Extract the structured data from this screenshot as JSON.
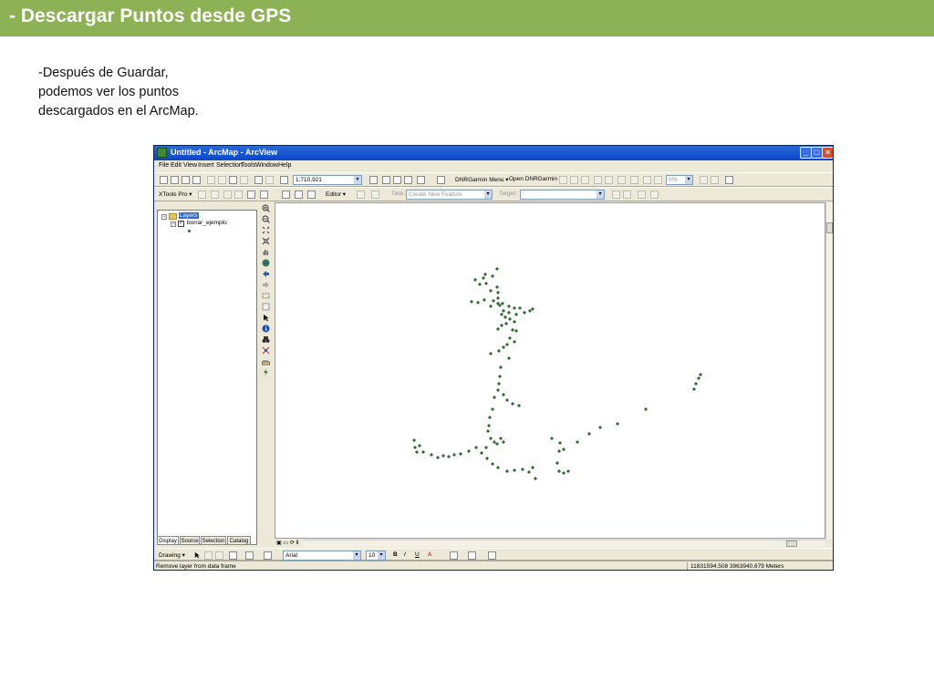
{
  "slide": {
    "title": "- Descargar Puntos desde GPS",
    "bullet": "-Después de Guardar, podemos ver los puntos descargados en el ArcMap.",
    "header_color": "#8db255"
  },
  "window": {
    "title": "Untitled - ArcMap - ArcView",
    "controls": [
      "_",
      "□",
      "×"
    ]
  },
  "menu": [
    "File",
    "Edit",
    "View",
    "Insert",
    "Selection",
    "Tools",
    "Window",
    "Help"
  ],
  "toolbar1": {
    "scale_value": "1:710,921",
    "dnr_menu_label": "DNRGarmin Menu ▾",
    "open_dnr_label": "Open DNRGarmin",
    "zoom_value": "0%"
  },
  "toolbar2": {
    "xtools_label": "XTools Pro ▾",
    "editor_label": "Editor ▾",
    "task_label": "Task:",
    "task_value": "Create New Feature",
    "target_label": "Target:"
  },
  "toc": {
    "root": "Layers",
    "layer": "borrar_ejemplo",
    "tabs": [
      "Display",
      "Source",
      "Selection",
      "Catalog"
    ]
  },
  "drawing": {
    "drawing_label": "Drawing ▾",
    "font_name": "Arial",
    "font_size": "10",
    "bold": "B",
    "italic": "I",
    "underline": "U",
    "font_color": "A"
  },
  "status": {
    "message": "Remove layer from data frame",
    "coordinates": "11831594.508  3963940.679 Meters"
  },
  "point_color": "#2e6b2e",
  "icons": {
    "tools": [
      "zoom-in-icon",
      "zoom-out-icon",
      "fixed-zoom-in-icon",
      "fixed-zoom-out-icon",
      "pan-icon",
      "full-extent-icon",
      "back-extent-icon",
      "forward-extent-icon",
      "select-elements-icon",
      "select-features-icon",
      "identify-icon",
      "find-icon",
      "go-to-xy-icon",
      "measure-icon",
      "hyperlink-icon"
    ]
  }
}
